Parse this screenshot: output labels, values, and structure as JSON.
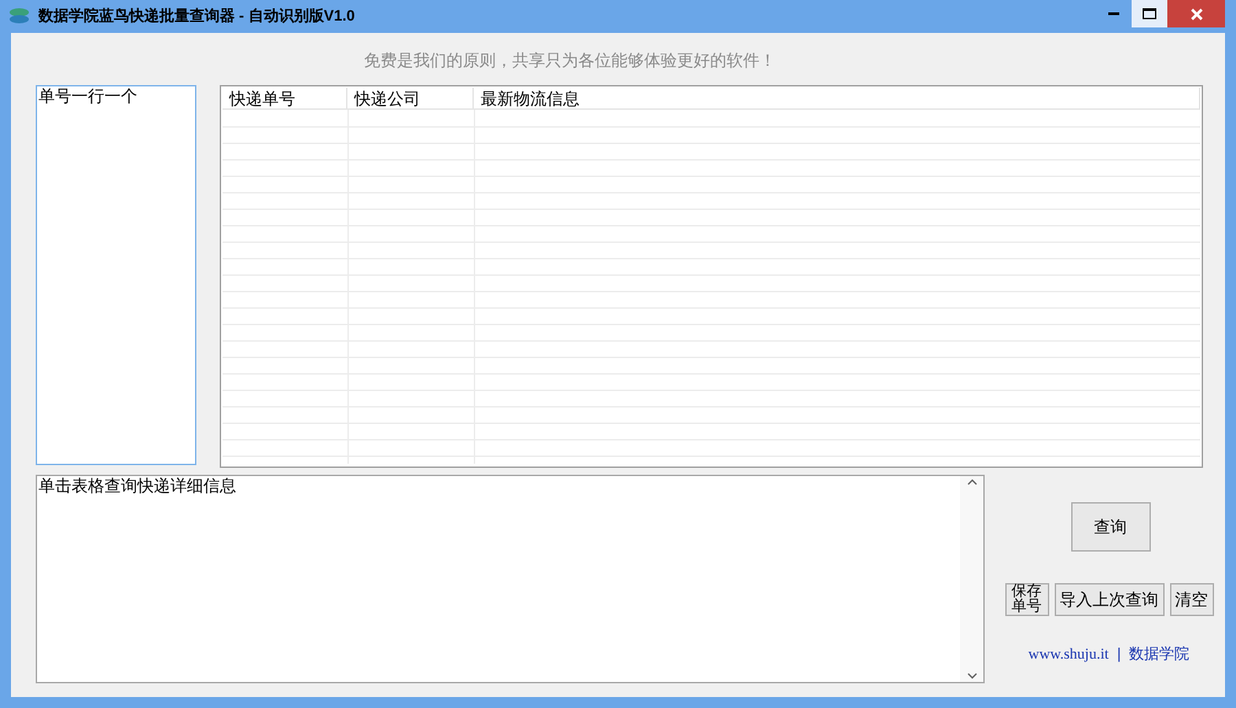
{
  "window": {
    "title": "数据学院蓝鸟快递批量查询器 - 自动识别版V1.0"
  },
  "slogan": "免费是我们的原则，共享只为各位能够体验更好的软件！",
  "numbers_input": {
    "value": "单号一行一个"
  },
  "table": {
    "columns": [
      "快递单号",
      "快递公司",
      "最新物流信息"
    ]
  },
  "detail": {
    "value": "单击表格查询快递详细信息"
  },
  "buttons": [
    {
      "label": "查询",
      "kind": "large"
    },
    {
      "label": "保存单号",
      "kind": "stacked"
    },
    {
      "label": "导入上次查询",
      "kind": "normal"
    },
    {
      "label": "清空",
      "kind": "normal"
    }
  ],
  "footer": {
    "link": "www.shuju.it",
    "separator": "|",
    "brand": "数据学院"
  }
}
